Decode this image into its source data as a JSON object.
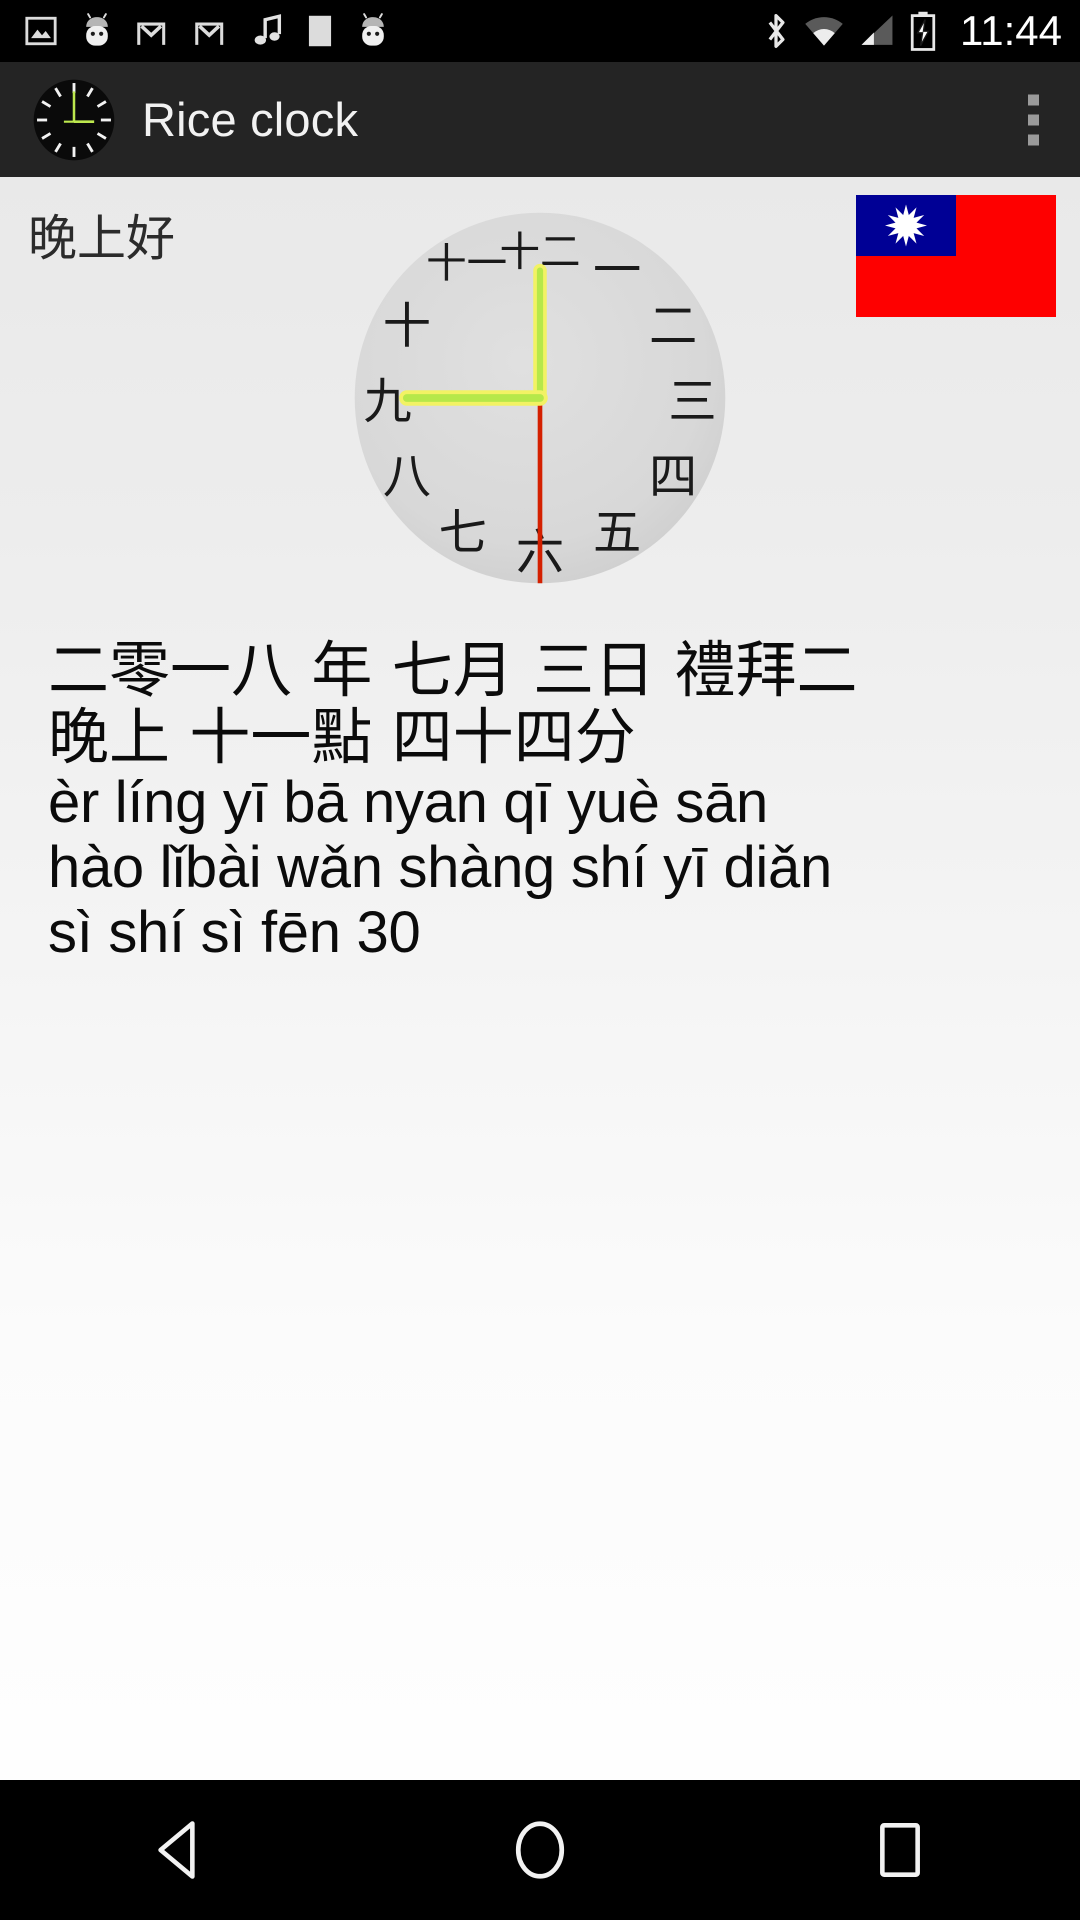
{
  "status_bar": {
    "time": "11:44",
    "left_icons": [
      "image-icon",
      "android-icon",
      "gmail-icon",
      "gmail-icon",
      "music-note-icon",
      "blank-square-icon",
      "android-icon"
    ],
    "right_icons": [
      "bluetooth-icon",
      "wifi-icon",
      "cellular-signal-icon",
      "battery-charging-icon"
    ]
  },
  "app_bar": {
    "title": "Rice clock",
    "icon": "clock-icon",
    "overflow_label": "More options"
  },
  "main": {
    "greeting": "晚上好",
    "flag": {
      "name": "taiwan-flag",
      "red": "#fe0000",
      "blue": "#000095",
      "sun": "#ffffff",
      "rays": 12
    },
    "clock": {
      "numerals": [
        "一",
        "二",
        "三",
        "四",
        "五",
        "六",
        "七",
        "八",
        "九",
        "十",
        "十一",
        "十二"
      ],
      "hour_hand_target": "九",
      "minute_hand_target": "十二",
      "second_hand_target": "六",
      "face_color": "#d8d8d8",
      "hand_color": "#b6e84a",
      "hand_highlight": "#f2f264",
      "second_hand_color": "#d42000"
    },
    "date_lines": [
      "二零一八 年 七月 三日 禮拜二",
      "晚上 十一點 四十四分"
    ],
    "pinyin_lines": [
      "èr líng yī bā nyan qī yuè sān",
      "hào lǐbài wǎn shàng shí yī diǎn",
      "sì shí sì fēn 30"
    ]
  },
  "nav_bar": {
    "back_label": "Back",
    "home_label": "Home",
    "recents_label": "Recent apps"
  }
}
